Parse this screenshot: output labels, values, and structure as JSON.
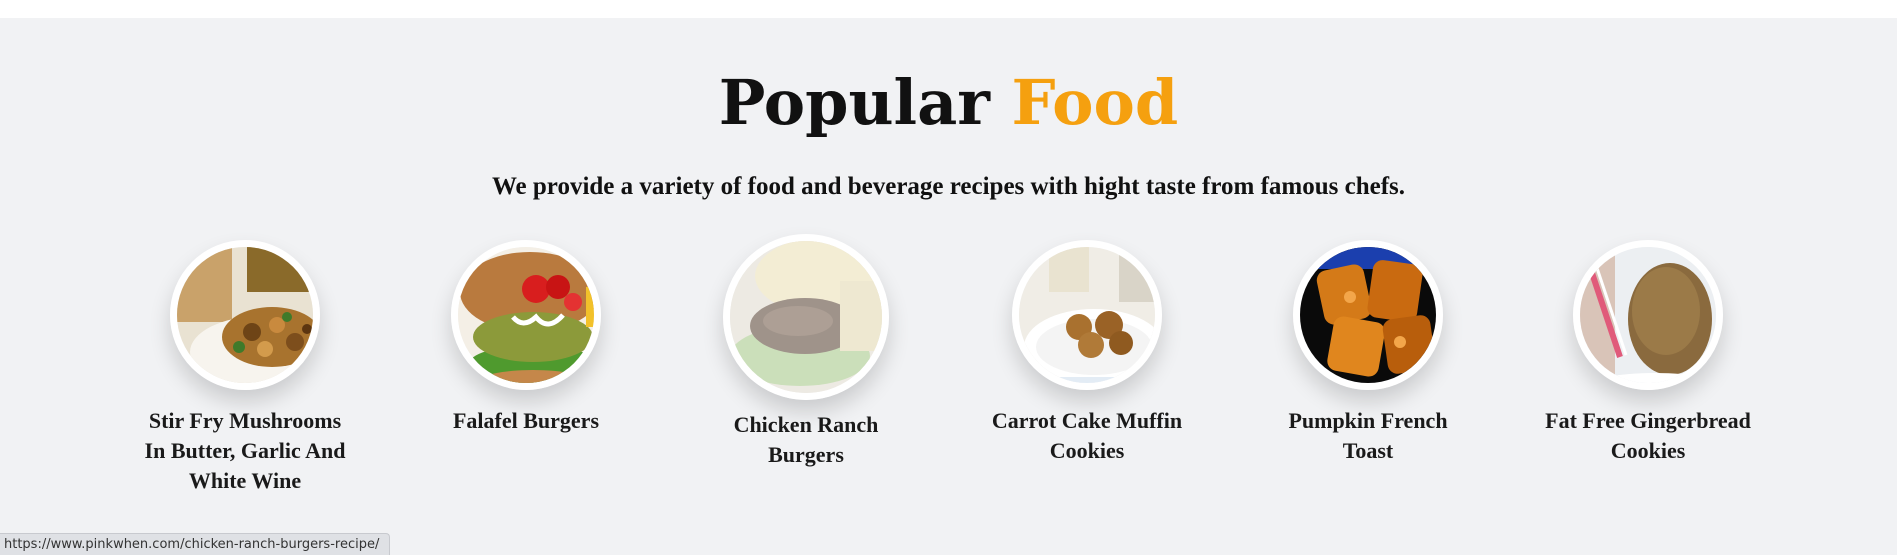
{
  "section": {
    "title_main": "Popular",
    "title_accent": "Food",
    "subtitle": "We provide a variety of food and beverage recipes with hight taste from famous chefs.",
    "accent_color": "#f5a00f"
  },
  "foods": [
    {
      "name": "Stir Fry Mushrooms In Butter, Garlic And White Wine",
      "image": "mushrooms-dish-photo"
    },
    {
      "name": "Falafel Burgers",
      "image": "falafel-burger-photo"
    },
    {
      "name": "Chicken Ranch Burgers",
      "image": "chicken-burger-photo"
    },
    {
      "name": "Carrot Cake Muffin Cookies",
      "image": "muffin-cookies-photo"
    },
    {
      "name": "Pumpkin French Toast",
      "image": "french-toast-photo"
    },
    {
      "name": "Fat Free Gingerbread Cookies",
      "image": "gingerbread-cookie-photo"
    }
  ],
  "status_bar": {
    "url": "https://www.pinkwhen.com/chicken-ranch-burgers-recipe/"
  }
}
